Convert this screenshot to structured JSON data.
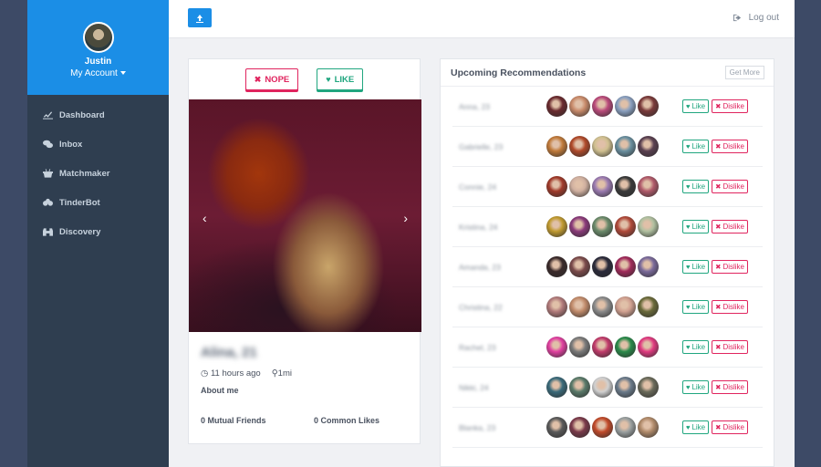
{
  "profile": {
    "name": "Justin",
    "account_label": "My Account"
  },
  "nav": [
    {
      "label": "Dashboard",
      "icon": "chart-icon"
    },
    {
      "label": "Inbox",
      "icon": "chat-icon"
    },
    {
      "label": "Matchmaker",
      "icon": "basket-icon"
    },
    {
      "label": "TinderBot",
      "icon": "robot-icon"
    },
    {
      "label": "Discovery",
      "icon": "binoculars-icon"
    }
  ],
  "topbar": {
    "upload_icon": "upload-icon",
    "logout_label": "Log out"
  },
  "card": {
    "nope_label": "NOPE",
    "like_label": "LIKE",
    "name": "Alina, 21",
    "time": "11 hours ago",
    "distance": "1mi",
    "about_label": "About me",
    "mutual_friends": "0 Mutual Friends",
    "common_likes": "0 Common Likes"
  },
  "recommendations": {
    "title": "Upcoming Recommendations",
    "get_more_label": "Get More",
    "like_label": "Like",
    "dislike_label": "Dislike",
    "rows": [
      {
        "name": "Anna, 23"
      },
      {
        "name": "Gabrielle, 23"
      },
      {
        "name": "Connie, 24"
      },
      {
        "name": "Kristina, 24"
      },
      {
        "name": "Amanda, 23"
      },
      {
        "name": "Christina, 22"
      },
      {
        "name": "Rachel, 23"
      },
      {
        "name": "Nikki, 24"
      },
      {
        "name": "Blanka, 23"
      }
    ]
  },
  "colors": {
    "accent": "#1b8ee6",
    "sidebar": "#2f3e50",
    "like": "#20a67f",
    "nope": "#e0245e"
  }
}
